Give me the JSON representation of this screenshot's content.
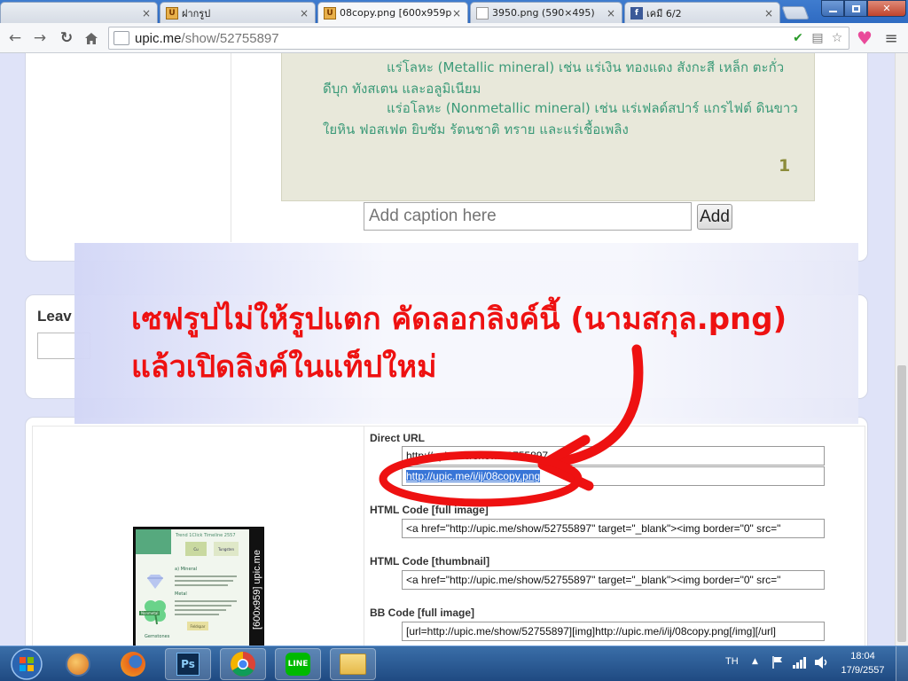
{
  "browser": {
    "tabs": [
      {
        "label": "",
        "close": "×"
      },
      {
        "label": "ฝากรูป",
        "close": "×"
      },
      {
        "label": "08copy.png [600x959p",
        "close": "×"
      },
      {
        "label": "3950.png (590×495)",
        "close": "×"
      },
      {
        "label": "เคมี 6/2",
        "close": "×"
      }
    ],
    "url_host": "upic.me",
    "url_path": "/show/52755897"
  },
  "page": {
    "article_lines": [
      "แร่โลหะ (Metallic mineral) เช่น แร่เงิน ทองแดง สังกะสี เหล็ก ตะกั่ว",
      "ดีบุก ทังสเตน และอลูมิเนียม",
      "แร่อโลหะ (Nonmetallic mineral) เช่น แร่เฟลด์สปาร์ แกรไฟต์ ดินขาว",
      "ใยหิน ฟอสเฟต ยิบซัม รัตนชาติ ทราย และแร่เชื้อเพลิง"
    ],
    "page_number": "1",
    "caption_placeholder": "Add caption here",
    "add_button": "Add",
    "leave_label": "Leav",
    "annotation_line1": "เซฟรูปไม่ให้รูปแตก คัดลอกลิงค์นี้ (นามสกุล.png)",
    "annotation_line2": "แล้วเปิดลิงค์ในแท็ปใหม่",
    "annotation_color": "#ee1111",
    "thumb_label": "[600x959] upic.me",
    "thumb_texts": {
      "title": "Trend 1Click Timeline 2557",
      "mineral": "a) Mineral",
      "metal": "Metal",
      "card1": "Cu",
      "card2": "Tungsten",
      "nonmetal": "Nonmetal",
      "card3": "Feldspar",
      "footer": "Gemstones"
    },
    "sections": {
      "direct_url": {
        "label": "Direct URL",
        "values": [
          "http://upic.me/show/52755897",
          "http://upic.me/i/ij/08copy.png"
        ]
      },
      "html_full": {
        "label": "HTML Code [full image]",
        "value": "<a href=\"http://upic.me/show/52755897\" target=\"_blank\"><img border=\"0\" src=\""
      },
      "html_thumb": {
        "label": "HTML Code [thumbnail]",
        "value": "<a href=\"http://upic.me/show/52755897\" target=\"_blank\"><img border=\"0\" src=\""
      },
      "bb_full": {
        "label": "BB Code [full image]",
        "value": "[url=http://upic.me/show/52755897][img]http://upic.me/i/ij/08copy.png[/img][/url]"
      }
    }
  },
  "taskbar": {
    "lang": "TH",
    "time": "18:04",
    "date": "17/9/2557",
    "apps": [
      "start",
      "orb",
      "firefox",
      "photoshop",
      "chrome",
      "line",
      "explorer"
    ]
  }
}
